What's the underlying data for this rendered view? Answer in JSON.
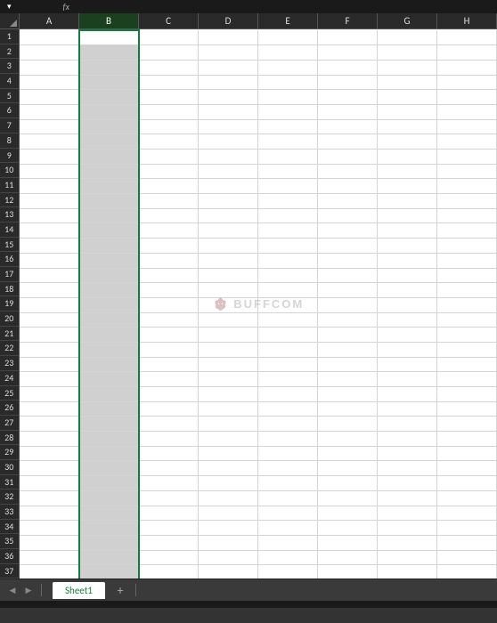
{
  "top": {
    "dropdown_indicator": "▾",
    "fx_label": "fx"
  },
  "columns": [
    "A",
    "B",
    "C",
    "D",
    "E",
    "F",
    "G",
    "H"
  ],
  "selected_column_index": 1,
  "rows": [
    "1",
    "2",
    "3",
    "4",
    "5",
    "6",
    "7",
    "8",
    "9",
    "10",
    "11",
    "12",
    "13",
    "14",
    "15",
    "16",
    "17",
    "18",
    "19",
    "20",
    "21",
    "22",
    "23",
    "24",
    "25",
    "26",
    "27",
    "28",
    "29",
    "30",
    "31",
    "32",
    "33",
    "34",
    "35",
    "36",
    "37"
  ],
  "watermark": {
    "text": "BUFFCOM"
  },
  "sheet_tabs": {
    "nav_prev": "◀",
    "nav_next": "▶",
    "active": "Sheet1",
    "add": "+"
  }
}
